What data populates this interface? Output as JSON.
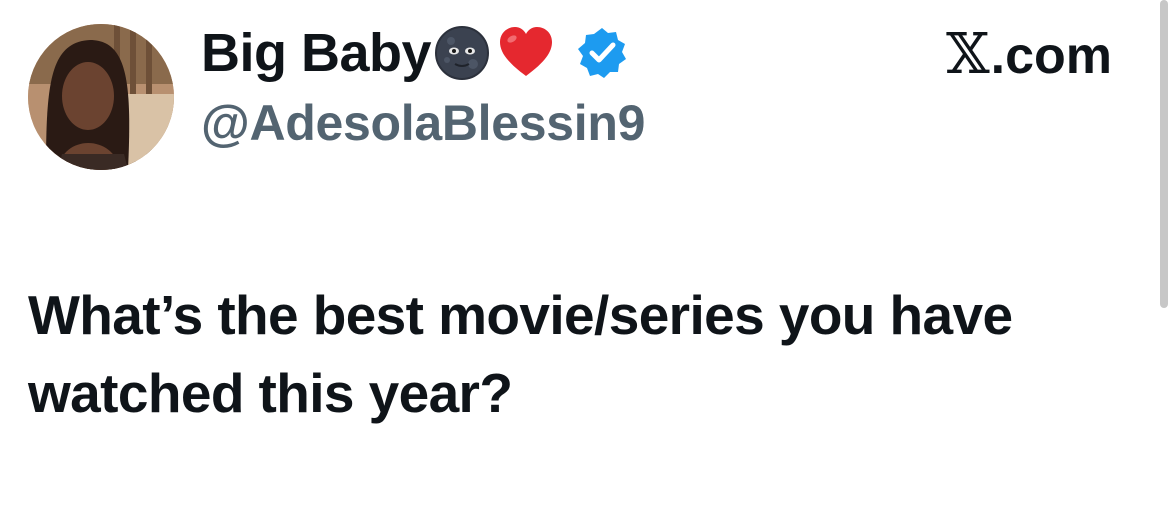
{
  "tweet": {
    "display_name": "Big Baby",
    "handle": "@AdesolaBlessin9",
    "brand": ".com",
    "text": "What’s the best movie/series you have watched this year?"
  },
  "icons": {
    "name_emoji_1": "new-moon-face-icon",
    "name_emoji_2": "red-heart-icon",
    "badge": "verified-badge-icon",
    "brand_logo": "x-logo-icon"
  },
  "colors": {
    "text": "#0f1419",
    "secondary": "#536471",
    "verified": "#1d9bf0",
    "heart": "#e5282f"
  }
}
